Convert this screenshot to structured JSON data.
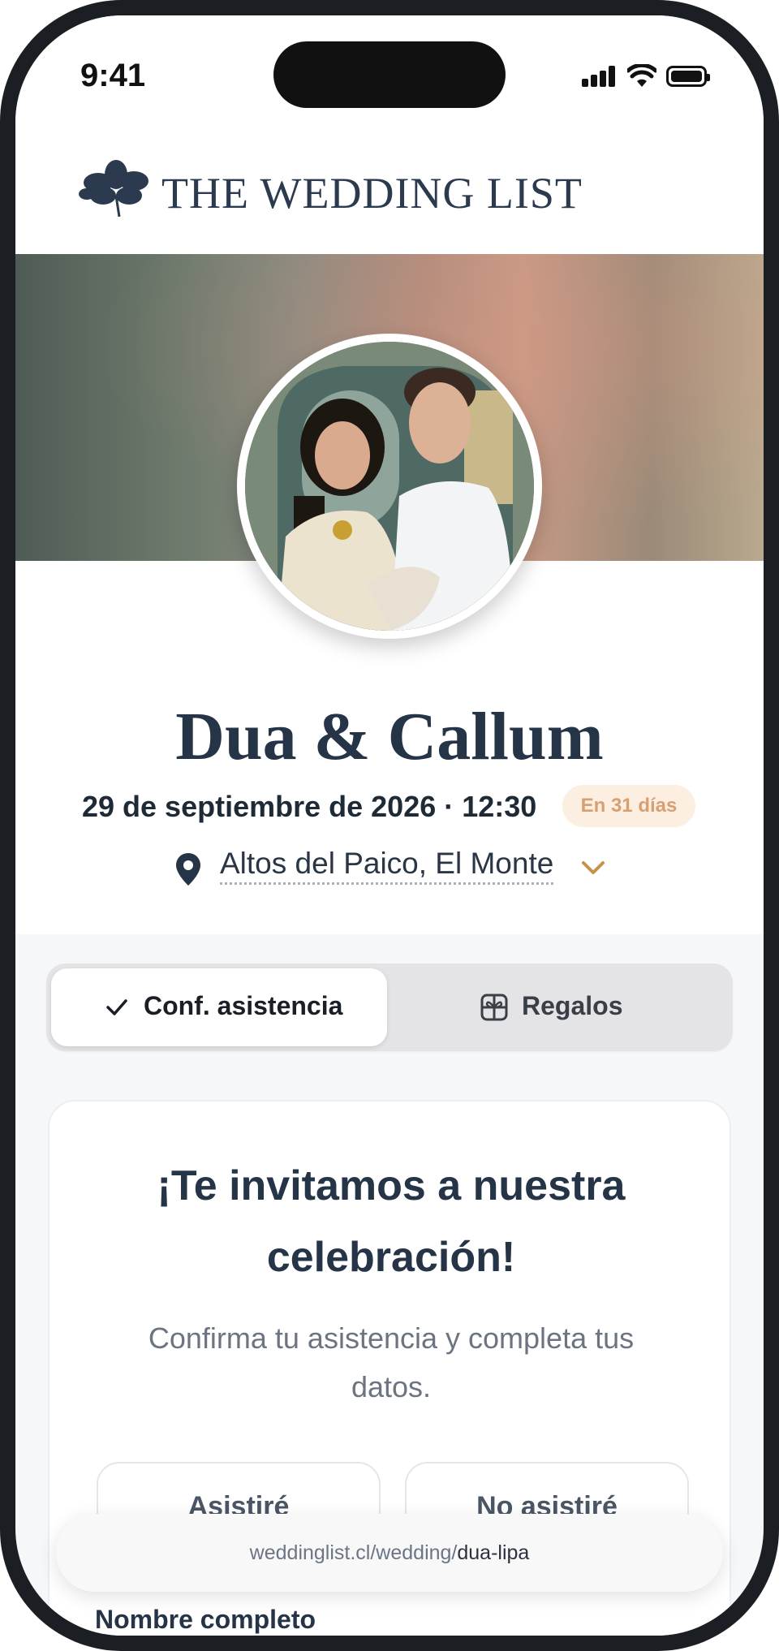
{
  "status_bar": {
    "time": "9:41"
  },
  "brand": {
    "name": "THE WEDDING LIST"
  },
  "profile": {
    "couple": "Dua & Callum",
    "date_time": "29 de septiembre de 2026 · 12:30",
    "countdown": "En 31 días",
    "location": "Altos del Paico, El Monte"
  },
  "tabs": [
    {
      "label": "Conf. asistencia",
      "icon": "check-icon",
      "active": true
    },
    {
      "label": "Regalos",
      "icon": "gift-icon",
      "active": false
    }
  ],
  "rsvp_card": {
    "title_line1": "¡Te invitamos a nuestra",
    "title_line2": "celebración!",
    "subtitle_line1": "Confirma tu asistencia y completa tus",
    "subtitle_line2": "datos.",
    "attend_label": "Asistiré",
    "decline_label": "No asistiré",
    "name_label": "Nombre completo"
  },
  "url_bar": {
    "host": "weddinglist.cl/wedding/",
    "path": "dua-lipa"
  },
  "colors": {
    "brand_navy": "#253447",
    "badge_bg": "#fcefe2",
    "badge_text": "#d7a072",
    "accent_gold": "#c6934e"
  }
}
